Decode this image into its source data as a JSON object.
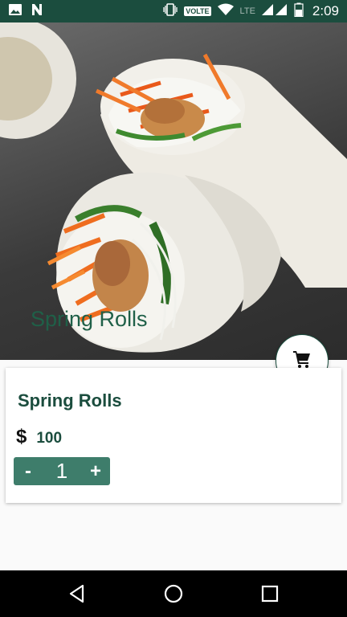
{
  "status_bar": {
    "time": "2:09",
    "volte_label": "VOLTE",
    "network_label": "LTE",
    "icons": [
      "image-icon",
      "n-app-icon",
      "vibrate-icon",
      "wifi-icon",
      "signal-icon",
      "battery-icon"
    ]
  },
  "hero": {
    "title": "Spring Rolls",
    "image": "spring-rolls-photo"
  },
  "fab": {
    "icon": "cart-icon"
  },
  "product": {
    "name": "Spring Rolls",
    "currency": "$",
    "price": "100"
  },
  "quantity": {
    "minus_label": "-",
    "value": "1",
    "plus_label": "+"
  },
  "nav_bar": {
    "icons": [
      "back-icon",
      "home-icon",
      "recents-icon"
    ]
  },
  "colors": {
    "primary": "#1b4d3e",
    "accent": "#3e7d6b",
    "title_green": "#1f6048"
  }
}
